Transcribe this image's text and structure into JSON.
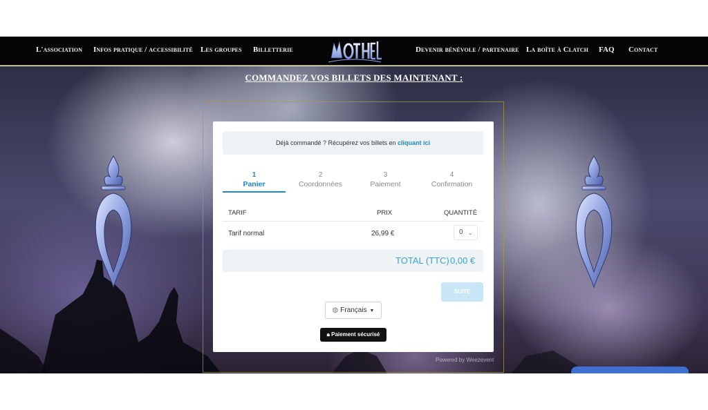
{
  "nav": {
    "left_items": [
      "L'association",
      "Infos pratique / accessibilité",
      "Les groupes",
      "Billetterie"
    ],
    "right_items": [
      "Devenir bénévole / partenaire",
      "La boîte à Clatch",
      "FAQ",
      "Contact"
    ],
    "logo_text": "MÖTÖHELL"
  },
  "hero": {
    "title": "COMMANDEZ VOS BILLETS DES MAINTENANT :"
  },
  "widget": {
    "notice_text": "Déjà commandé ? Récupérez vos billets en ",
    "notice_link": "cliquant ici",
    "steps": [
      {
        "num": "1",
        "label": "Panier",
        "active": true
      },
      {
        "num": "2",
        "label": "Coordonnées",
        "active": false
      },
      {
        "num": "3",
        "label": "Paiement",
        "active": false
      },
      {
        "num": "4",
        "label": "Confirmation",
        "active": false
      }
    ],
    "table": {
      "headers": [
        "TARIF",
        "PRIX",
        "QUANTITÉ"
      ],
      "rows": [
        {
          "tarif": "Tarif normal",
          "prix": "26,99 €",
          "quantite": "0"
        }
      ]
    },
    "total_label": "TOTAL (TTC)",
    "total_value": "0,00 €",
    "suite_label": "SUITE",
    "language": "Français",
    "secure_label": "Paiement sécurisé",
    "powered_by": "Powered by Weezevent"
  },
  "colors": {
    "accent": "#1a88c9",
    "nav_bg": "#050505",
    "gold_border": "#8a7a3a"
  }
}
